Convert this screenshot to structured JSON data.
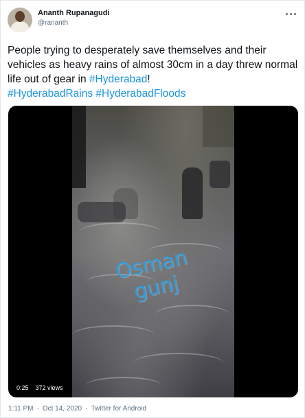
{
  "author": {
    "name": "Ananth Rupanagudi",
    "handle": "@rananth"
  },
  "tweet": {
    "text_1": "People trying to desperately save themselves and their vehicles as heavy rains of almost 30cm in a day threw normal life out of gear in ",
    "hashtag_1": "#Hyderabad",
    "text_2": "!",
    "hashtag_2": "#HyderabadRains",
    "hashtag_3": "#HyderabadFloods"
  },
  "video": {
    "overlay_text": "Osman\ngunj",
    "duration": "0:25",
    "views": "372 views"
  },
  "footer": {
    "time": "1:11 PM",
    "separator_1": "·",
    "date": "Oct 14, 2020",
    "separator_2": "·",
    "source": "Twitter for Android"
  },
  "colors": {
    "link": "#1b95e0",
    "secondary_text": "#5b7083",
    "overlay_text": "#2f9ddc"
  },
  "icons": {
    "more": "more-horizontal-icon"
  }
}
